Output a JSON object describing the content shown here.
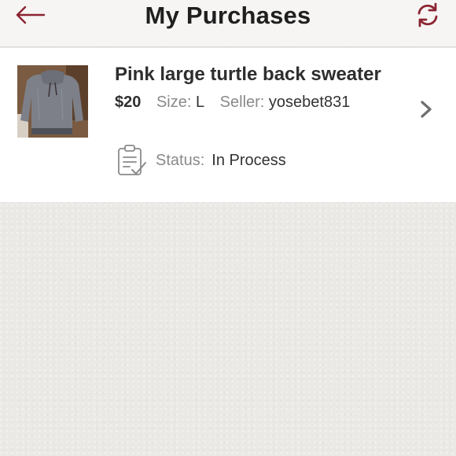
{
  "header": {
    "title": "My Purchases",
    "back_icon": "arrow-left-icon",
    "refresh_icon": "refresh-icon",
    "accent_color": "#8b2331"
  },
  "purchase": {
    "title": "Pink large turtle back sweater",
    "price": "$20",
    "size_label": "Size:",
    "size_value": "L",
    "seller_label": "Seller:",
    "seller_value": "yosebet831",
    "status_label": "Status:",
    "status_value": "In Process",
    "status_icon": "clipboard-check-icon",
    "chevron_icon": "chevron-right-icon"
  }
}
